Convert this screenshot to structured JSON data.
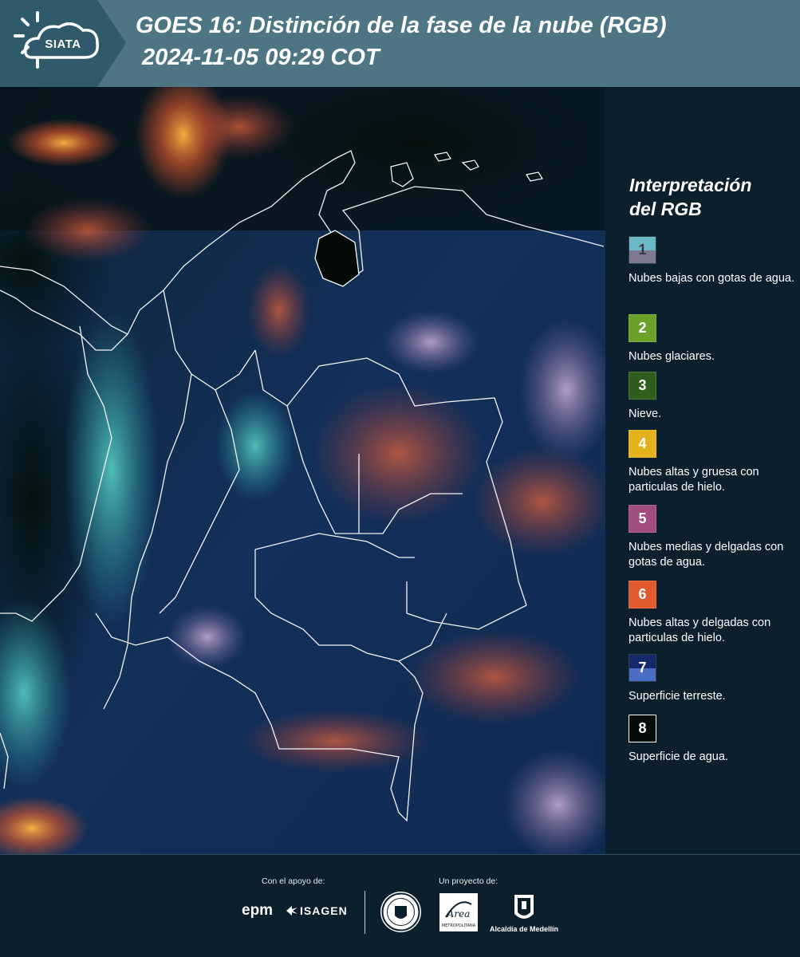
{
  "header": {
    "logo_text": "SIATA",
    "title_line1": "GOES 16: Distinción de la fase de la nube (RGB)",
    "title_line2": "2024-11-05 09:29 COT",
    "background_color": "#4e7583",
    "logo_background_color": "#2f5a6a"
  },
  "map": {
    "satellite": "GOES 16",
    "icon": "satellite-rgb-map-image"
  },
  "legend": {
    "title_line1": "Interpretación",
    "title_line2": "del RGB",
    "items": [
      {
        "number": "1",
        "label": "Nubes bajas con gotas de agua.",
        "color_top": "#6bb9c7",
        "color_bottom": "#7d7a92"
      },
      {
        "number": "2",
        "label": "Nubes glaciares.",
        "color": "#6ba02a"
      },
      {
        "number": "3",
        "label": "Nieve.",
        "color": "#2f5d1b"
      },
      {
        "number": "4",
        "label": "Nubes altas y gruesa con particulas de hielo.",
        "color": "#e3b21c"
      },
      {
        "number": "5",
        "label": "Nubes medias y delgadas con gotas de agua.",
        "color": "#a34d7e"
      },
      {
        "number": "6",
        "label": "Nubes altas y delgadas con particulas de hielo.",
        "color": "#e05a2e"
      },
      {
        "number": "7",
        "label": "Superficie terreste.",
        "color_top": "#14286a",
        "color_bottom": "#4a6fc4"
      },
      {
        "number": "8",
        "label": "Superficie de agua.",
        "color": "#060d08"
      }
    ]
  },
  "footer": {
    "support_label": "Con el apoyo de:",
    "project_label": "Un proyecto de:",
    "epm_text": "epm",
    "isagen_text": "ISAGEN",
    "area_text": "Área",
    "area_subtext": "METROPOLITANA",
    "medellin_text": "Alcaldía de Medellín"
  }
}
